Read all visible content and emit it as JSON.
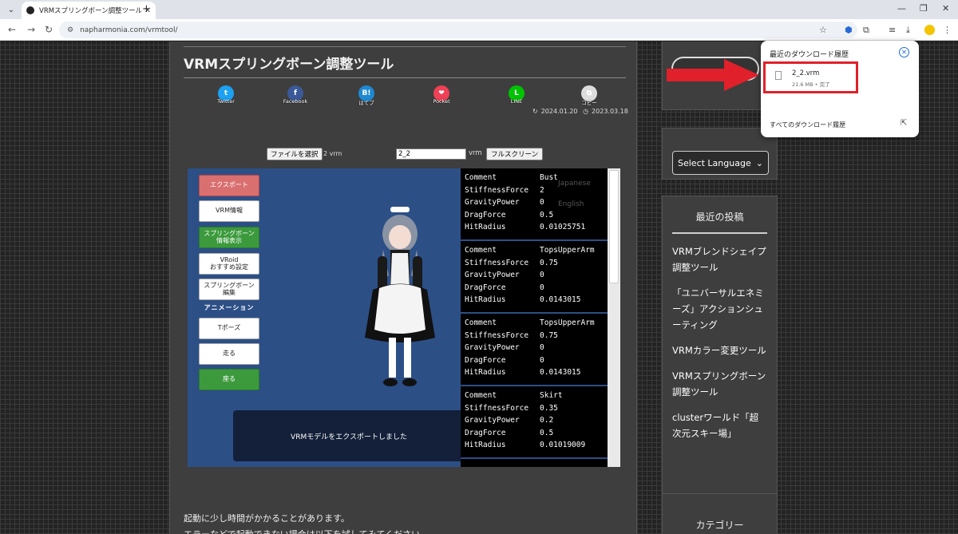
{
  "browser": {
    "tab_title": "VRMスプリングボーン調整ツール | N",
    "url": "napharmonia.com/vrmtool/"
  },
  "article": {
    "title": "VRMスプリングボーン調整ツール",
    "share": [
      {
        "label": "Twitter",
        "glyph": "t",
        "color": "#1da1f2"
      },
      {
        "label": "Facebook",
        "glyph": "f",
        "color": "#3b5998"
      },
      {
        "label": "はてブ",
        "glyph": "B!",
        "color": "#1e88d3"
      },
      {
        "label": "Pocket",
        "glyph": "❤",
        "color": "#ef4056"
      },
      {
        "label": "LINE",
        "glyph": "L",
        "color": "#00c300"
      },
      {
        "label": "コピー",
        "glyph": "⧉",
        "color": "#ddd"
      }
    ],
    "updated": "2024.01.20",
    "published": "2023.03.18",
    "file_button": "ファイルを選択",
    "file_chosen": "2 vrm",
    "name_value": "2_2",
    "ext_label": "vrm",
    "fullscreen_button": "フルスクリーン",
    "body_line1": "起動に少し時間がかかることがあります。",
    "body_line2": "エラーなどで起動できない場合は以下を試してみてください。"
  },
  "tool": {
    "buttons": {
      "export": "エクスポート",
      "vrm_info": "VRM情報",
      "spring_info": "スプリングボーン\n情報表示",
      "vroid_recommend": "VRoid\nおすすめ設定",
      "spring_edit": "スプリングボーン\n編集",
      "t_pose": "Tポーズ",
      "run": "走る",
      "sit": "座る"
    },
    "animation_label": "アニメーション",
    "toast": "VRMモデルをエクスポートしました",
    "lang_ghost_1": "Japanese",
    "lang_ghost_2": "English",
    "bones": [
      {
        "rows": [
          [
            "Comment",
            "Bust"
          ],
          [
            "StiffnessForce",
            "2"
          ],
          [
            "GravityPower",
            "0"
          ],
          [
            "DragForce",
            "0.5"
          ],
          [
            "HitRadius",
            "0.01025751"
          ]
        ]
      },
      {
        "rows": [
          [
            "Comment",
            "TopsUpperArm"
          ],
          [
            "StiffnessForce",
            "0.75"
          ],
          [
            "GravityPower",
            "0"
          ],
          [
            "DragForce",
            "0"
          ],
          [
            "HitRadius",
            "0.0143015"
          ]
        ]
      },
      {
        "rows": [
          [
            "Comment",
            "TopsUpperArm"
          ],
          [
            "StiffnessForce",
            "0.75"
          ],
          [
            "GravityPower",
            "0"
          ],
          [
            "DragForce",
            "0"
          ],
          [
            "HitRadius",
            "0.0143015"
          ]
        ]
      },
      {
        "rows": [
          [
            "Comment",
            "Skirt"
          ],
          [
            "StiffnessForce",
            "0.35"
          ],
          [
            "GravityPower",
            "0.2"
          ],
          [
            "DragForce",
            "0.5"
          ],
          [
            "HitRadius",
            "0.01019009"
          ]
        ]
      }
    ]
  },
  "sidebar": {
    "language_select": "Select Language",
    "recent_title": "最近の投稿",
    "posts": [
      "VRMブレンドシェイプ調整ツール",
      "「ユニバーサルエネミーズ」アクションシューティング",
      "VRMカラー変更ツール",
      "VRMスプリングボーン調整ツール",
      "clusterワールド「超次元スキー場」"
    ],
    "category_title": "カテゴリー"
  },
  "downloads": {
    "heading": "最近のダウンロード履歴",
    "file_name": "2_2.vrm",
    "file_meta": "21.6 MB • 完了",
    "all_link": "すべてのダウンロード履歴"
  },
  "colors": {
    "highlight": "#e0202a",
    "accent": "#1a6fd3"
  }
}
